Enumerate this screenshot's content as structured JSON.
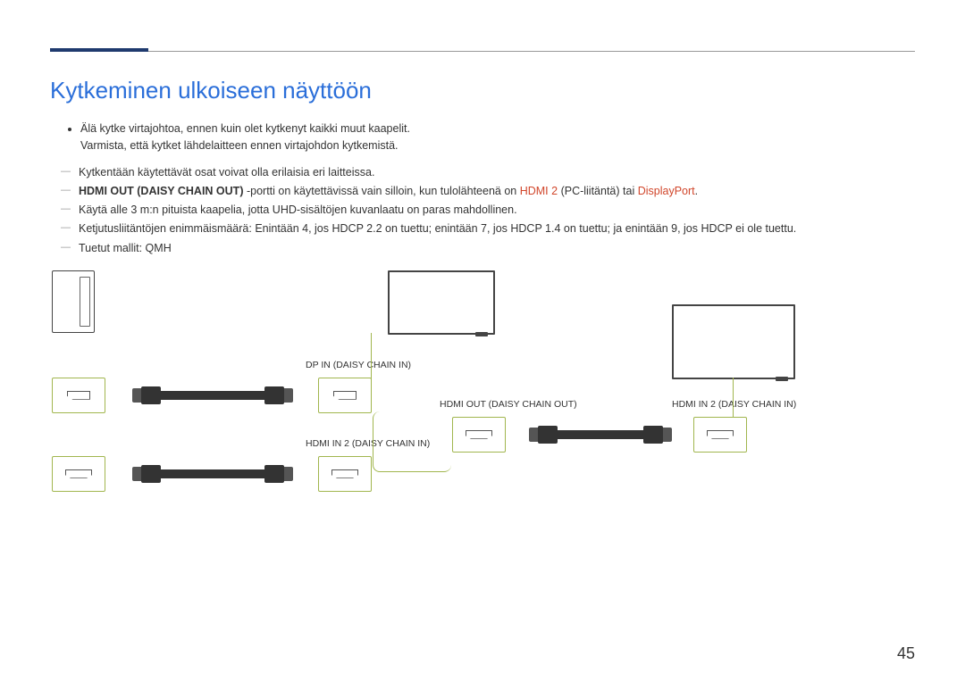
{
  "heading": "Kytkeminen ulkoiseen näyttöön",
  "bullet1": "Älä kytke virtajohtoa, ennen kuin olet kytkenyt kaikki muut kaapelit.",
  "bullet1b": "Varmista, että kytket lähdelaitteen ennen virtajohdon kytkemistä.",
  "d1": "Kytkentään käytettävät osat voivat olla erilaisia eri laitteissa.",
  "d2a": "HDMI OUT (DAISY CHAIN OUT)",
  "d2b": " -portti on käytettävissä vain silloin, kun tulolähteenä on ",
  "d2c": "HDMI 2",
  "d2d": " (PC-liitäntä) tai ",
  "d2e": "DisplayPort",
  "d2f": ".",
  "d3": "Käytä alle 3 m:n pituista kaapelia, jotta UHD-sisältöjen kuvanlaatu on paras mahdollinen.",
  "d4": "Ketjutusliitäntöjen enimmäismäärä: Enintään 4, jos HDCP 2.2 on tuettu; enintään 7, jos HDCP 1.4 on tuettu; ja enintään 9, jos HDCP ei ole tuettu.",
  "d5": "Tuetut mallit: QMH",
  "labels": {
    "dp_in": "DP IN (DAISY CHAIN IN)",
    "hdmi_in2_a": "HDMI IN 2 (DAISY CHAIN IN)",
    "hdmi_out": "HDMI OUT (DAISY CHAIN OUT)",
    "hdmi_in2_b": "HDMI IN 2 (DAISY CHAIN IN)"
  },
  "page_number": "45"
}
